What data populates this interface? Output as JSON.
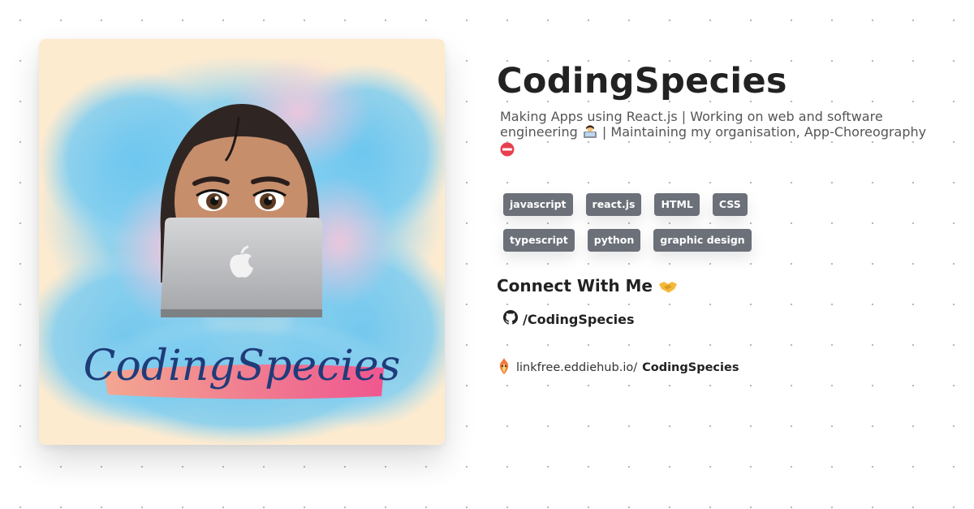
{
  "profile": {
    "name": "CodingSpecies",
    "bio_part1": "Making Apps using React.js | Working on web and software engineering",
    "bio_part2": "| Maintaining my organisation, App-Choreography",
    "avatar_text": "CodingSpecies"
  },
  "tags": [
    "javascript",
    "react.js",
    "HTML",
    "CSS",
    "typescript",
    "python",
    "graphic design"
  ],
  "connect": {
    "title": "Connect With Me",
    "github_handle": "/CodingSpecies"
  },
  "footer": {
    "url_prefix": "linkfree.eddiehub.io/",
    "username": "CodingSpecies"
  },
  "colors": {
    "tag_bg": "#6b7079",
    "avatar_bg": "#fdebd0",
    "sky_blue": "#5bbfe8",
    "script_navy": "#1f3c7a",
    "brush_pink": "#f7799a"
  },
  "icons": [
    "github-icon",
    "handshake-icon",
    "technologist-icon",
    "no-entry-icon",
    "linkfree-logo-icon"
  ]
}
